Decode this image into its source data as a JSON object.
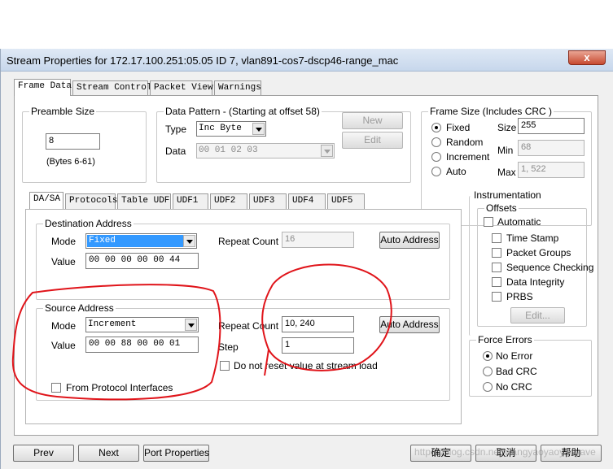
{
  "window": {
    "title": "Stream Properties for 172.17.100.251:05.05  ID 7, vlan891-cos7-dscp46-range_mac",
    "close_glyph": "x"
  },
  "top_tabs": [
    "Frame Data",
    "Stream Control",
    "Packet View",
    "Warnings"
  ],
  "preamble": {
    "label": "Preamble Size",
    "value": "8",
    "hint": "(Bytes 6-61)"
  },
  "data_pattern": {
    "label": "Data Pattern - (Starting at offset 58)",
    "type_label": "Type",
    "type_value": "Inc Byte",
    "data_label": "Data",
    "data_value": "00 01 02 03",
    "new_label": "New",
    "edit_label": "Edit"
  },
  "frame_size": {
    "label": "Frame Size  (Includes CRC )",
    "options": [
      "Fixed",
      "Random",
      "Increment",
      "Auto"
    ],
    "selected": "Fixed",
    "size_label": "Size",
    "size_value": "255",
    "min_label": "Min",
    "min_value": "68",
    "max_label": "Max",
    "max_value": "1, 522"
  },
  "inner_tabs": [
    "DA/SA",
    "Protocols",
    "Table UDF",
    "UDF1",
    "UDF2",
    "UDF3",
    "UDF4",
    "UDF5"
  ],
  "destination": {
    "label": "Destination Address",
    "mode_label": "Mode",
    "mode_value": "Fixed",
    "value_label": "Value",
    "value": "00 00 00 00 00 44",
    "repeat_label": "Repeat Count",
    "repeat_value": "16",
    "auto_label": "Auto Address"
  },
  "source": {
    "label": "Source Address",
    "mode_label": "Mode",
    "mode_value": "Increment",
    "value_label": "Value",
    "value": "00 00 88 00 00 01",
    "repeat_label": "Repeat Count",
    "repeat_value": "10, 240",
    "step_label": "Step",
    "step_value": "1",
    "auto_label": "Auto Address",
    "no_reset_label": "Do not reset value at stream load",
    "from_protocol_label": "From Protocol Interfaces"
  },
  "instrumentation": {
    "label": "Instrumentation",
    "offsets_label": "Offsets",
    "automatic_label": "Automatic",
    "items": [
      "Time Stamp",
      "Packet Groups",
      "Sequence Checking",
      "Data Integrity",
      "PRBS"
    ],
    "edit_label": "Edit..."
  },
  "force_errors": {
    "label": "Force Errors",
    "options": [
      "No Error",
      "Bad CRC",
      "No CRC"
    ],
    "selected": "No Error"
  },
  "bottom": {
    "prev": "Prev",
    "next": "Next",
    "port_props": "Port Properties",
    "ok": "确定",
    "cancel": "取消",
    "help": "帮助",
    "watermark": "https://blog.csdn.net/wangyaoyaoyaoyave"
  },
  "colors": {
    "selection": "#3399ff",
    "annotation": "#e0141a"
  }
}
